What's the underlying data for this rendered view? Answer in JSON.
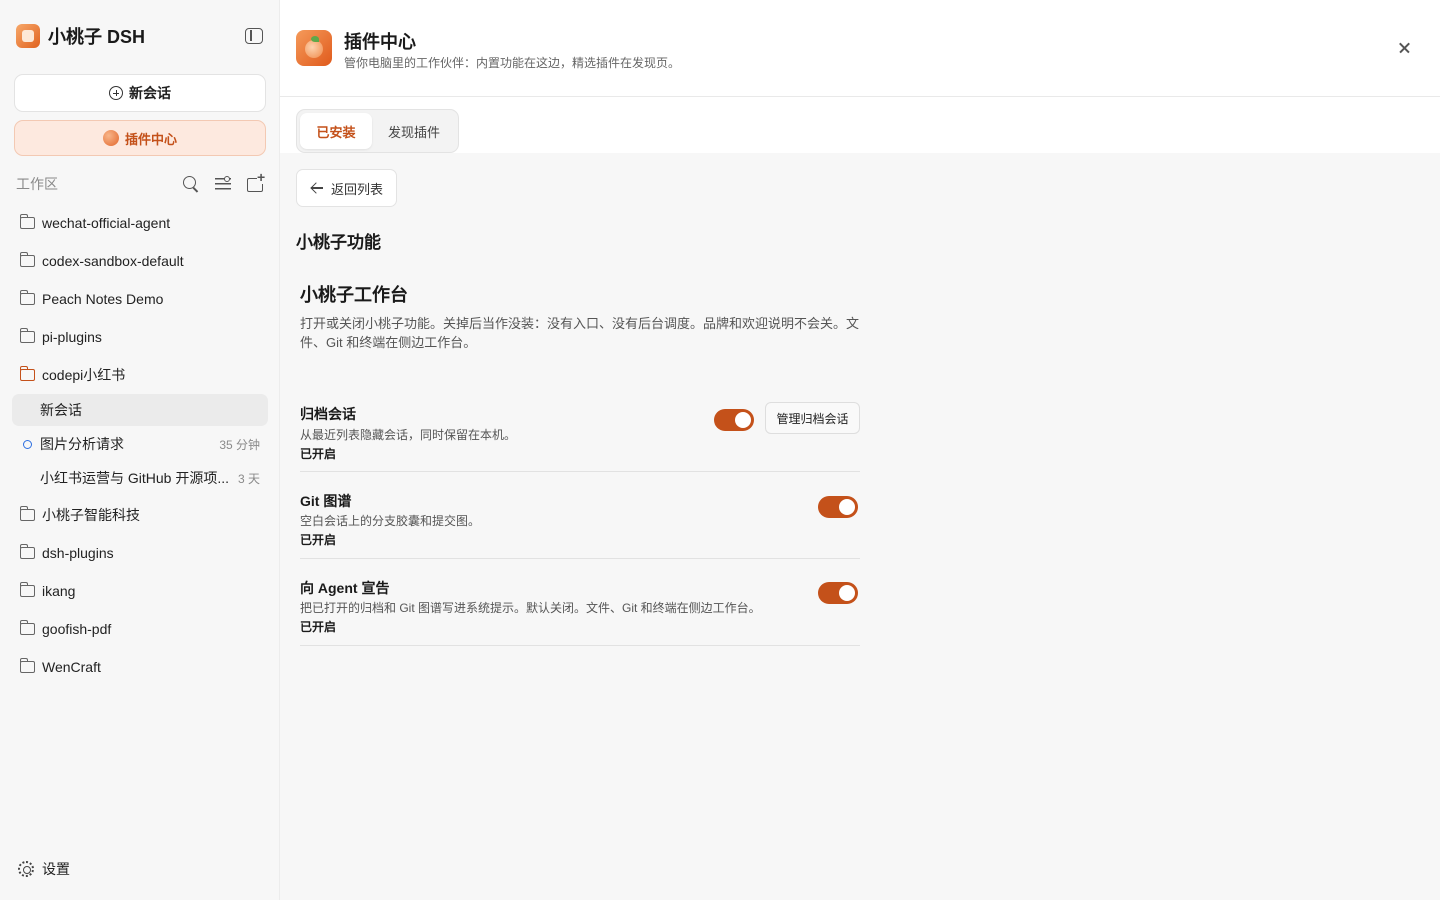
{
  "app": {
    "name": "小桃子 DSH"
  },
  "sidebar": {
    "new_chat_label": "新会话",
    "plugin_center_label": "插件中心",
    "workspace_label": "工作区",
    "folders_top": [
      "wechat-official-agent",
      "codex-sandbox-default",
      "Peach Notes Demo",
      "pi-plugins"
    ],
    "open_folder": {
      "name": "codepi小红书",
      "sessions": [
        {
          "title": "新会话",
          "time": ""
        },
        {
          "title": "图片分析请求",
          "time": "35 分钟"
        },
        {
          "title": "小红书运营与 GitHub 开源项...",
          "time": "3 天"
        }
      ]
    },
    "folders_bottom": [
      "小桃子智能科技",
      "dsh-plugins",
      "ikang",
      "goofish-pdf",
      "WenCraft"
    ],
    "settings_label": "设置"
  },
  "header": {
    "title": "插件中心",
    "subtitle": "管你电脑里的工作伙伴：内置功能在这边，精选插件在发现页。"
  },
  "tabs": {
    "installed": "已安装",
    "discover": "发现插件"
  },
  "back_label": "返回列表",
  "section_title": "小桃子功能",
  "plugin": {
    "name": "小桃子工作台",
    "description": "打开或关闭小桃子功能。关掉后当作没装：没有入口、没有后台调度。品牌和欢迎说明不会关。文件、Git 和终端在侧边工作台。",
    "settings": [
      {
        "title": "归档会话",
        "description": "从最近列表隐藏会话，同时保留在本机。",
        "state": "已开启",
        "enabled": true,
        "action_label": "管理归档会话"
      },
      {
        "title": "Git 图谱",
        "description": "空白会话上的分支胶囊和提交图。",
        "state": "已开启",
        "enabled": true
      },
      {
        "title": "向 Agent 宣告",
        "description": "把已打开的归档和 Git 图谱写进系统提示。默认关闭。文件、Git 和终端在侧边工作台。",
        "state": "已开启",
        "enabled": true
      }
    ]
  },
  "colors": {
    "accent": "#c4511a",
    "accent_bg": "#fde9df",
    "sidebar_bg": "#f7f7f7"
  }
}
